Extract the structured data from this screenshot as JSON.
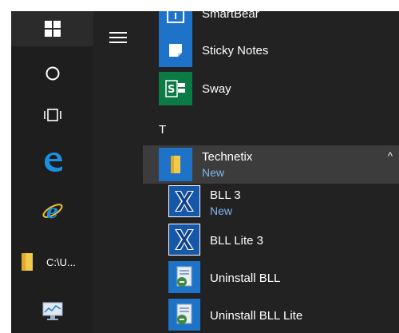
{
  "taskbar": {
    "explorer_label": "C:\\U..."
  },
  "menu": {
    "apps": [
      {
        "name": "SmartBear",
        "icon": "smartbear-icon"
      },
      {
        "name": "Sticky Notes",
        "icon": "sticky-notes-icon"
      },
      {
        "name": "Sway",
        "icon": "sway-icon"
      }
    ],
    "section_letter": "T",
    "folder": {
      "name": "Technetix",
      "badge": "New",
      "expanded_indicator": "^"
    },
    "folder_items": [
      {
        "name": "BLL 3",
        "badge": "New",
        "icon": "bll-x-icon"
      },
      {
        "name": "BLL Lite 3",
        "badge": "",
        "icon": "bll-x-icon"
      },
      {
        "name": "Uninstall BLL",
        "badge": "",
        "icon": "uninstall-icon"
      },
      {
        "name": "Uninstall BLL Lite",
        "badge": "",
        "icon": "uninstall-icon"
      }
    ]
  },
  "colors": {
    "accent": "#1e73c8",
    "new_badge": "#7fb8ee",
    "background": "#222222",
    "selected_row": "#3c3c3c"
  }
}
